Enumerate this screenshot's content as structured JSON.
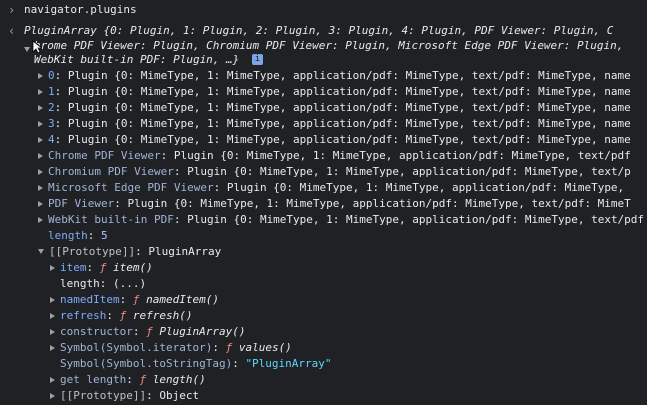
{
  "input": {
    "prompt_glyph": "›",
    "command": "navigator.plugins"
  },
  "output": {
    "return_glyph": "‹",
    "summary_lines": [
      "PluginArray {0: Plugin, 1: Plugin, 2: Plugin, 3: Plugin, 4: Plugin, PDF Viewer: Plugin, C",
      "hrome PDF Viewer: Plugin, Chromium PDF Viewer: Plugin, Microsoft Edge PDF Viewer: Plugin,",
      "WebKit built-in PDF: Plugin, …}"
    ],
    "info_badge": "i",
    "items": [
      {
        "key": "0",
        "value": "Plugin {0: MimeType, 1: MimeType, application/pdf: MimeType, text/pdf: MimeType, name"
      },
      {
        "key": "1",
        "value": "Plugin {0: MimeType, 1: MimeType, application/pdf: MimeType, text/pdf: MimeType, name"
      },
      {
        "key": "2",
        "value": "Plugin {0: MimeType, 1: MimeType, application/pdf: MimeType, text/pdf: MimeType, name"
      },
      {
        "key": "3",
        "value": "Plugin {0: MimeType, 1: MimeType, application/pdf: MimeType, text/pdf: MimeType, name"
      },
      {
        "key": "4",
        "value": "Plugin {0: MimeType, 1: MimeType, application/pdf: MimeType, text/pdf: MimeType, name"
      },
      {
        "key": "Chrome PDF Viewer",
        "value": "Plugin {0: MimeType, 1: MimeType, application/pdf: MimeType, text/pdf"
      },
      {
        "key": "Chromium PDF Viewer",
        "value": "Plugin {0: MimeType, 1: MimeType, application/pdf: MimeType, text/p"
      },
      {
        "key": "Microsoft Edge PDF Viewer",
        "value": "Plugin {0: MimeType, 1: MimeType, application/pdf: MimeType,"
      },
      {
        "key": "PDF Viewer",
        "value": "Plugin {0: MimeType, 1: MimeType, application/pdf: MimeType, text/pdf: MimeT"
      },
      {
        "key": "WebKit built-in PDF",
        "value": "Plugin {0: MimeType, 1: MimeType, application/pdf: MimeType, text/pdf"
      }
    ],
    "length": {
      "key": "length",
      "value": "5"
    },
    "prototype": {
      "key": "[[Prototype]]",
      "value": "PluginArray",
      "members": [
        {
          "key": "item",
          "value": "item()"
        },
        {
          "key": "length",
          "value": "(...)"
        },
        {
          "key": "namedItem",
          "value": "namedItem()"
        },
        {
          "key": "refresh",
          "value": "refresh()"
        },
        {
          "key": "constructor",
          "value": "PluginArray()"
        },
        {
          "key": "Symbol(Symbol.iterator)",
          "value": "values()"
        },
        {
          "key": "Symbol(Symbol.toStringTag)",
          "value": "\"PluginArray\""
        },
        {
          "key": "get length",
          "value": "length()"
        },
        {
          "key": "[[Prototype]]",
          "value": "Object"
        }
      ],
      "f_glyph": "ƒ"
    }
  },
  "colors": {
    "background": "#202124",
    "key": "#7cacf8",
    "function": "#f28b82",
    "string": "#5cd5fb",
    "number": "#a8c7fa"
  }
}
